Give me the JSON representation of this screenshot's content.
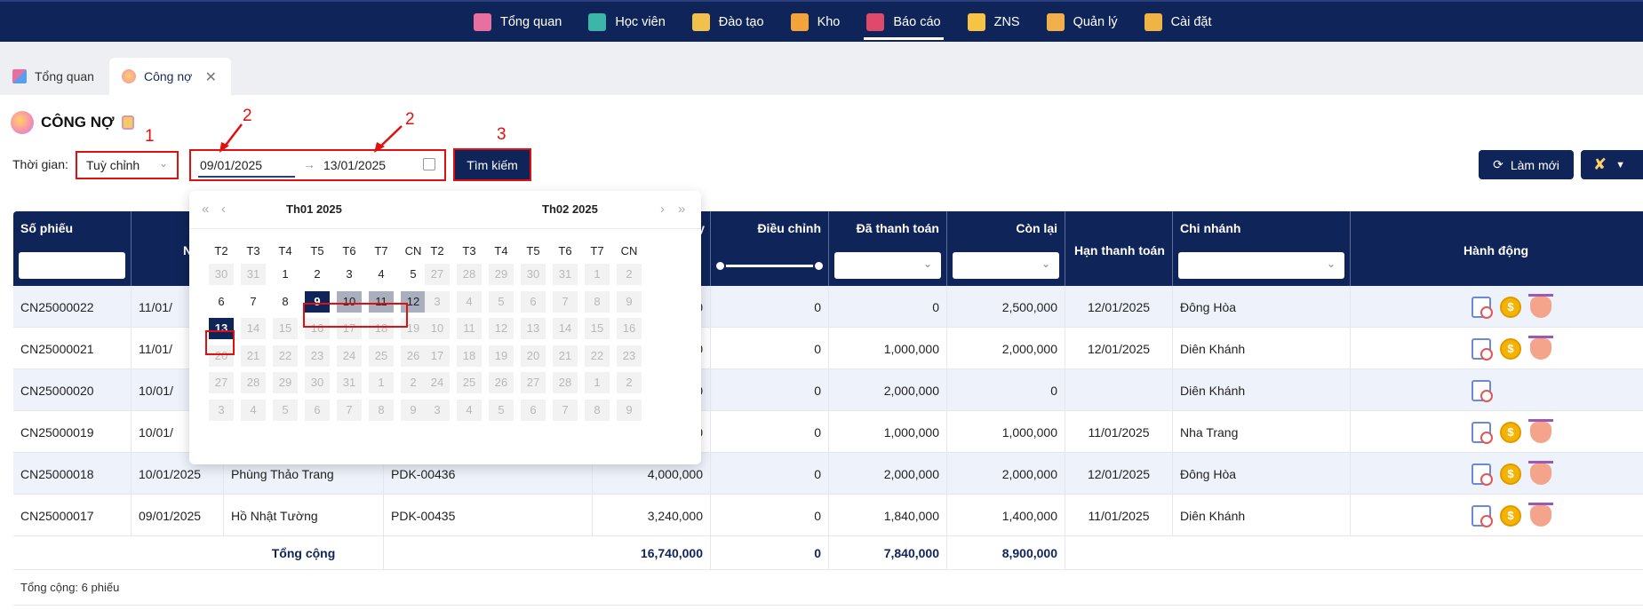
{
  "nav": {
    "items": [
      {
        "label": "Tổng quan",
        "color": "#e86fa0"
      },
      {
        "label": "Học viên",
        "color": "#3bb6a8"
      },
      {
        "label": "Đào tạo",
        "color": "#f0c14b"
      },
      {
        "label": "Kho",
        "color": "#f3a33a"
      },
      {
        "label": "Báo cáo",
        "color": "#e04a6a"
      },
      {
        "label": "ZNS",
        "color": "#f6c343"
      },
      {
        "label": "Quản lý",
        "color": "#f2b04a"
      },
      {
        "label": "Cài đặt",
        "color": "#f0b445"
      }
    ],
    "active": "Báo cáo"
  },
  "tabs": [
    {
      "label": "Tổng quan"
    },
    {
      "label": "Công nợ"
    }
  ],
  "page": {
    "title": "CÔNG NỢ",
    "time_label": "Thời gian:",
    "period": "Tuỳ chỉnh",
    "date_from": "09/01/2025",
    "date_to": "13/01/2025",
    "search": "Tìm kiếm",
    "refresh": "Làm mới"
  },
  "annotations": [
    "1",
    "2",
    "2",
    "3"
  ],
  "table": {
    "headers": {
      "so_phieu": "Số phiếu",
      "ngay": "Nga",
      "col_y": "y",
      "dieu_chinh": "Điều chỉnh",
      "da_thanh_toan": "Đã thanh toán",
      "con_lai": "Còn lại",
      "han": "Hạn thanh toán",
      "chi_nhanh": "Chi nhánh",
      "hanh_dong": "Hành động"
    },
    "rows": [
      {
        "so": "CN25000022",
        "ngay": "11/01/",
        "ten": "",
        "ma": "",
        "tong": "0",
        "dc": "0",
        "dtt": "0",
        "cl": "2,500,000",
        "han": "12/01/2025",
        "cn": "Đông Hòa",
        "acts": 3
      },
      {
        "so": "CN25000021",
        "ngay": "11/01/",
        "ten": "",
        "ma": "",
        "tong": "0",
        "dc": "0",
        "dtt": "1,000,000",
        "cl": "2,000,000",
        "han": "12/01/2025",
        "cn": "Diên Khánh",
        "acts": 3
      },
      {
        "so": "CN25000020",
        "ngay": "10/01/",
        "ten": "",
        "ma": "",
        "tong": "0",
        "dc": "0",
        "dtt": "2,000,000",
        "cl": "0",
        "han": "",
        "cn": "Diên Khánh",
        "acts": 1
      },
      {
        "so": "CN25000019",
        "ngay": "10/01/",
        "ten": "",
        "ma": "",
        "tong": "0",
        "dc": "0",
        "dtt": "1,000,000",
        "cl": "1,000,000",
        "han": "11/01/2025",
        "cn": "Nha Trang",
        "acts": 3
      },
      {
        "so": "CN25000018",
        "ngay": "10/01/2025",
        "ten": "Phùng Thảo Trang",
        "ma": "PDK-00436",
        "tong": "4,000,000",
        "dc": "0",
        "dtt": "2,000,000",
        "cl": "2,000,000",
        "han": "12/01/2025",
        "cn": "Đông Hòa",
        "acts": 3
      },
      {
        "so": "CN25000017",
        "ngay": "09/01/2025",
        "ten": "Hồ Nhật Tường",
        "ma": "PDK-00435",
        "tong": "3,240,000",
        "dc": "0",
        "dtt": "1,840,000",
        "cl": "1,400,000",
        "han": "11/01/2025",
        "cn": "Diên Khánh",
        "acts": 3
      }
    ],
    "total": {
      "label": "Tổng cộng",
      "tong": "16,740,000",
      "dc": "0",
      "dtt": "7,840,000",
      "cl": "8,900,000"
    },
    "footer": "Tổng cộng: 6 phiếu"
  },
  "calendar": {
    "left_title": "Th01  2025",
    "right_title": "Th02  2025",
    "dow": [
      "T2",
      "T3",
      "T4",
      "T5",
      "T6",
      "T7",
      "CN"
    ],
    "left_days": [
      [
        "30",
        "31",
        "1",
        "2",
        "3",
        "4",
        "5"
      ],
      [
        "6",
        "7",
        "8",
        "9",
        "10",
        "11",
        "12"
      ],
      [
        "13",
        "14",
        "15",
        "16",
        "17",
        "18",
        "19"
      ],
      [
        "20",
        "21",
        "22",
        "23",
        "24",
        "25",
        "26"
      ],
      [
        "27",
        "28",
        "29",
        "30",
        "31",
        "1",
        "2"
      ],
      [
        "3",
        "4",
        "5",
        "6",
        "7",
        "8",
        "9"
      ]
    ],
    "right_days": [
      [
        "27",
        "28",
        "29",
        "30",
        "31",
        "1",
        "2"
      ],
      [
        "3",
        "4",
        "5",
        "6",
        "7",
        "8",
        "9"
      ],
      [
        "10",
        "11",
        "12",
        "13",
        "14",
        "15",
        "16"
      ],
      [
        "17",
        "18",
        "19",
        "20",
        "21",
        "22",
        "23"
      ],
      [
        "24",
        "25",
        "26",
        "27",
        "28",
        "1",
        "2"
      ],
      [
        "3",
        "4",
        "5",
        "6",
        "7",
        "8",
        "9"
      ]
    ]
  }
}
